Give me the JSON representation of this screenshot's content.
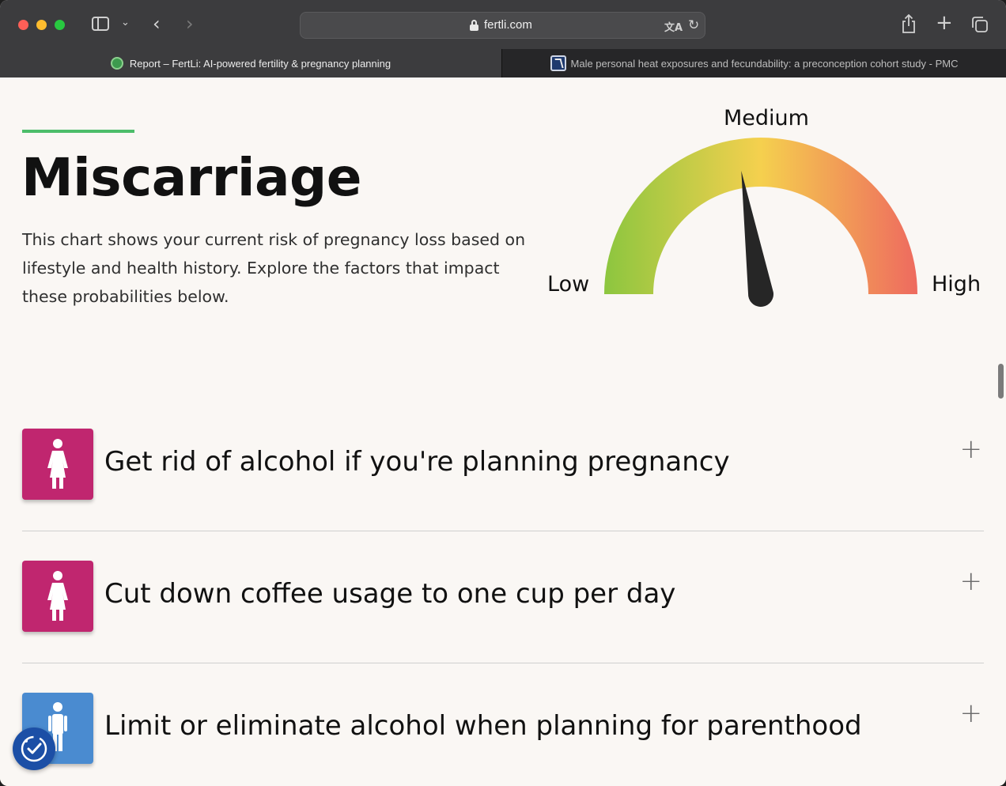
{
  "browser": {
    "url": "fertli.com",
    "tabs": [
      {
        "label": "Report – FertLi: AI-powered fertility & pregnancy planning",
        "active": true
      },
      {
        "label": "Male personal heat exposures and fecundability: a preconception cohort study - PMC",
        "active": false
      }
    ]
  },
  "header": {
    "title": "Miscarriage",
    "description": "This chart shows your current risk of pregnancy loss based on lifestyle and health history. Explore the factors that impact these probabilities below."
  },
  "gauge": {
    "low_label": "Low",
    "medium_label": "Medium",
    "high_label": "High",
    "level": 0.45,
    "colors": [
      "#8cc63f",
      "#f5d04e",
      "#ee6a5f"
    ]
  },
  "recommendations": [
    {
      "text": "Get rid of alcohol if you're planning pregnancy",
      "icon": "female-icon",
      "color": "#c0266f",
      "expand": "+"
    },
    {
      "text": "Cut down coffee usage to one cup per day",
      "icon": "female-icon",
      "color": "#c0266f",
      "expand": "+"
    },
    {
      "text": "Limit or eliminate alcohol when planning for parenthood",
      "icon": "male-icon",
      "color": "#4a8bd0",
      "expand": "+"
    }
  ]
}
